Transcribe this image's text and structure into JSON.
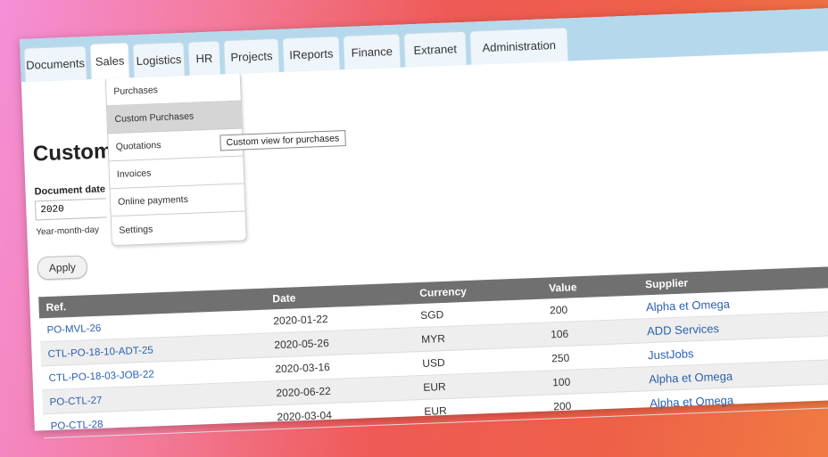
{
  "tabs": [
    {
      "label": "Documents"
    },
    {
      "label": "Sales"
    },
    {
      "label": "Logistics"
    },
    {
      "label": "HR"
    },
    {
      "label": "Projects"
    },
    {
      "label": "IReports"
    },
    {
      "label": "Finance"
    },
    {
      "label": "Extranet"
    },
    {
      "label": "Administration"
    }
  ],
  "active_tab": "Sales",
  "dropdown": {
    "items": [
      {
        "label": "Purchases"
      },
      {
        "label": "Custom Purchases"
      },
      {
        "label": "Quotations"
      },
      {
        "label": "Invoices"
      },
      {
        "label": "Online payments"
      },
      {
        "label": "Settings"
      }
    ],
    "highlighted": "Custom Purchases",
    "tooltip": "Custom view for purchases"
  },
  "page": {
    "title": "Custom"
  },
  "filter": {
    "label": "Document date",
    "value": "2020",
    "hint": "Year-month-day",
    "apply_label": "Apply"
  },
  "table": {
    "headers": [
      "Ref.",
      "Date",
      "Currency",
      "Value",
      "Supplier"
    ],
    "rows": [
      {
        "ref": "PO-MVL-26",
        "date": "2020-01-22",
        "currency": "SGD",
        "value": "200",
        "supplier": "Alpha et Omega"
      },
      {
        "ref": "CTL-PO-18-10-ADT-25",
        "date": "2020-05-26",
        "currency": "MYR",
        "value": "106",
        "supplier": "ADD Services"
      },
      {
        "ref": "CTL-PO-18-03-JOB-22",
        "date": "2020-03-16",
        "currency": "USD",
        "value": "250",
        "supplier": "JustJobs"
      },
      {
        "ref": "PO-CTL-27",
        "date": "2020-06-22",
        "currency": "EUR",
        "value": "100",
        "supplier": "Alpha et Omega"
      },
      {
        "ref": "PO-CTL-28",
        "date": "2020-03-04",
        "currency": "EUR",
        "value": "200",
        "supplier": "Alpha et Omega"
      }
    ]
  },
  "colors": {
    "tabbar": "#b6d8ec",
    "link": "#2b5fae",
    "table_header": "#707070"
  }
}
